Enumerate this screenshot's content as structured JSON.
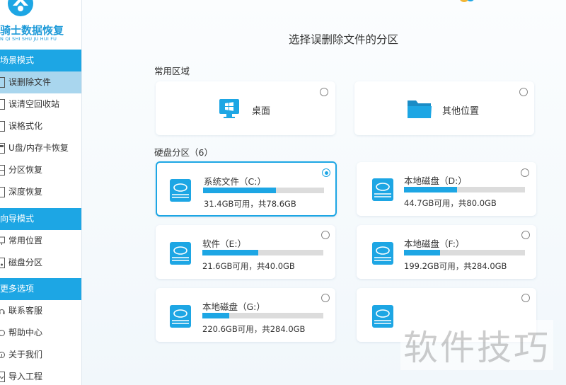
{
  "app": {
    "logo_title": "骑士数据恢复",
    "logo_sub": "N QI SHI SHU JU HUI FU"
  },
  "sidebar": {
    "sections": [
      {
        "header": "场景模式",
        "items": [
          {
            "label": "误删除文件",
            "icon": "file-icon",
            "active": true
          },
          {
            "label": "误清空回收站",
            "icon": "file-icon",
            "active": false
          },
          {
            "label": "误格式化",
            "icon": "file-icon",
            "active": false
          },
          {
            "label": "U盘/内存卡恢复",
            "icon": "usb-icon",
            "active": false
          },
          {
            "label": "分区恢复",
            "icon": "partition-icon",
            "active": false
          },
          {
            "label": "深度恢复",
            "icon": "file-icon",
            "active": false
          }
        ]
      },
      {
        "header": "向导模式",
        "items": [
          {
            "label": "常用位置",
            "icon": "monitor-icon",
            "active": false
          },
          {
            "label": "磁盘分区",
            "icon": "disk-icon",
            "active": false
          }
        ]
      },
      {
        "header": "更多选项",
        "items": [
          {
            "label": "联系客服",
            "icon": "headset-icon",
            "active": false
          },
          {
            "label": "帮助中心",
            "icon": "help-icon",
            "active": false
          },
          {
            "label": "关于我们",
            "icon": "info-icon",
            "active": false
          },
          {
            "label": "导入工程",
            "icon": "import-icon",
            "active": false
          }
        ]
      }
    ]
  },
  "main": {
    "title": "选择误删除文件的分区",
    "common_label": "常用区域",
    "common_cards": [
      {
        "label": "桌面",
        "icon": "desktop-icon",
        "selected": false
      },
      {
        "label": "其他位置",
        "icon": "folder-icon",
        "selected": false
      }
    ],
    "disk_label": "硬盘分区（6）",
    "drives": [
      {
        "name": "系统文件（C:）",
        "info": "31.4GB可用，共78.6GB",
        "used_fraction": 0.6,
        "selected": true
      },
      {
        "name": "本地磁盘（D:）",
        "info": "44.7GB可用，共80.0GB",
        "used_fraction": 0.44,
        "selected": false
      },
      {
        "name": "软件（E:）",
        "info": "21.6GB可用，共40.0GB",
        "used_fraction": 0.46,
        "selected": false
      },
      {
        "name": "本地磁盘（F:）",
        "info": "199.2GB可用，共284.0GB",
        "used_fraction": 0.3,
        "selected": false
      },
      {
        "name": "本地磁盘（G:）",
        "info": "220.6GB可用，共284.0GB",
        "used_fraction": 0.22,
        "selected": false
      },
      {
        "name": "",
        "info": "",
        "used_fraction": 0,
        "selected": false
      }
    ]
  },
  "watermark": "软件技巧",
  "colors": {
    "accent": "#1da6e4",
    "active_item": "#a9d6ee"
  }
}
